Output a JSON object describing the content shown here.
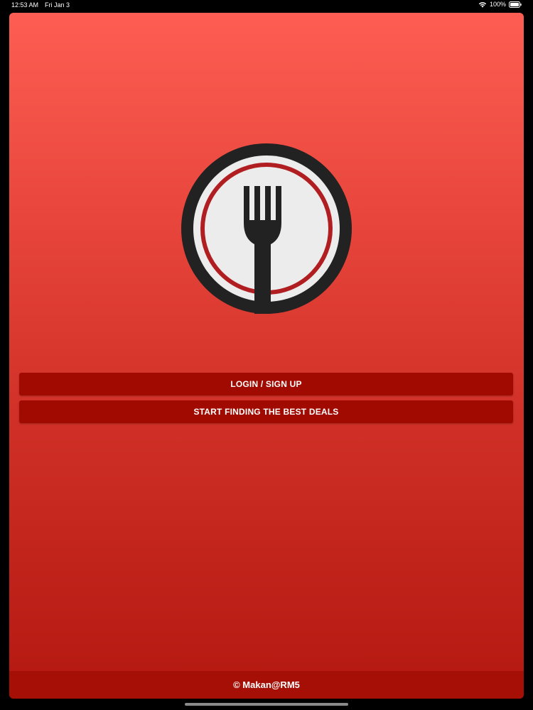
{
  "status_bar": {
    "time": "12:53 AM",
    "date": "Fri Jan 3",
    "battery_percent": "100%",
    "icons": [
      "wifi-icon",
      "battery-icon"
    ]
  },
  "logo": {
    "icon": "fork-plate-logo",
    "colors": {
      "outer_ring": "#222222",
      "plate": "#ececec",
      "inner_ring": "#b01e22",
      "fork": "#222222"
    }
  },
  "buttons": {
    "login_label": "LOGIN / SIGN UP",
    "deals_label": "START FINDING THE BEST DEALS"
  },
  "footer": {
    "copyright": "© Makan@RM5"
  },
  "colors": {
    "background_top": "#fd5d52",
    "background_bottom": "#b31810",
    "button": "#a10a00",
    "footer": "#a60f05",
    "text": "#ffffff"
  }
}
